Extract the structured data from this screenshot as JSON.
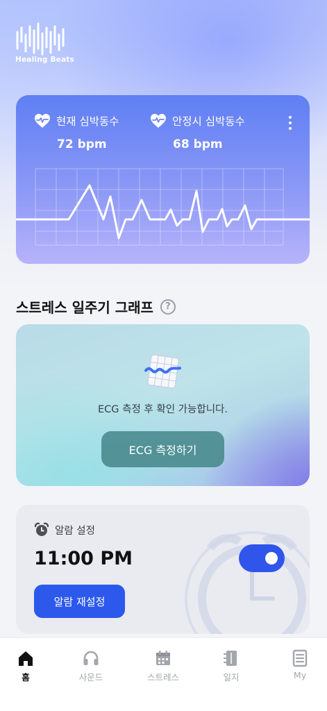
{
  "app": {
    "name": "Healing Beats"
  },
  "heart_rate": {
    "current_label": "현재 심박동수",
    "current_value": "72 bpm",
    "resting_label": "안정시 심박동수",
    "resting_value": "68 bpm"
  },
  "stress": {
    "title": "스트레스 일주기 그래프",
    "message": "ECG 측정 후 확인 가능합니다.",
    "button_label": "ECG 측정하기"
  },
  "alarm": {
    "header_label": "알람 설정",
    "time": "11:00 PM",
    "enabled": true,
    "reset_label": "알람 재설정"
  },
  "nav": {
    "items": [
      {
        "label": "홈",
        "icon": "home-icon",
        "active": true
      },
      {
        "label": "사운드",
        "icon": "headphones-icon",
        "active": false
      },
      {
        "label": "스트레스",
        "icon": "calendar-icon",
        "active": false
      },
      {
        "label": "일지",
        "icon": "journal-icon",
        "active": false
      },
      {
        "label": "My",
        "icon": "profile-doc-icon",
        "active": false
      }
    ]
  },
  "colors": {
    "primary": "#2c59ec",
    "hr_card_top": "#5f7ff4",
    "hr_card_bottom": "#b7b3fb",
    "ecg_button": "#4f8f93"
  }
}
